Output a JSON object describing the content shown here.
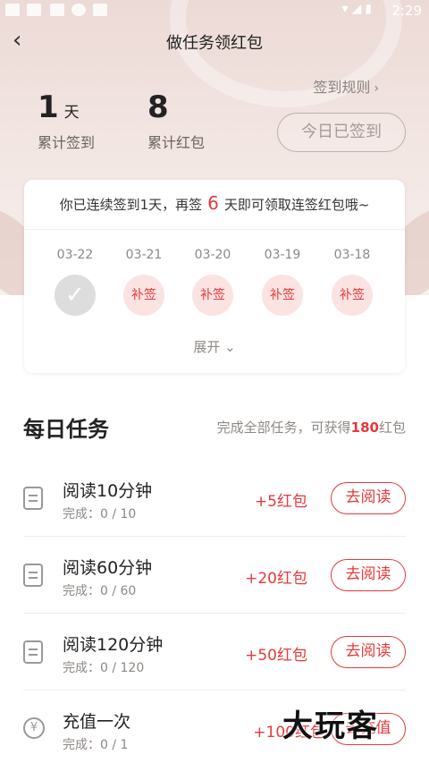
{
  "status_bar": {
    "time": "2:29"
  },
  "header": {
    "title": "做任务领红包",
    "back_icon": "back-chevron-icon"
  },
  "summary": {
    "rules_link": "签到规则",
    "days_value": "1",
    "days_unit": "天",
    "days_caption": "累计签到",
    "packets_value": "8",
    "packets_caption": "累计红包",
    "checkin_button": "今日已签到"
  },
  "checkin_card": {
    "msg_prefix": "你已连续签到1天，再签",
    "msg_days": "6",
    "msg_suffix": "天即可领取连签红包哦~",
    "days": [
      {
        "date": "03-22",
        "status": "done",
        "label": ""
      },
      {
        "date": "03-21",
        "status": "makeup",
        "label": "补签"
      },
      {
        "date": "03-20",
        "status": "makeup",
        "label": "补签"
      },
      {
        "date": "03-19",
        "status": "makeup",
        "label": "补签"
      },
      {
        "date": "03-18",
        "status": "makeup",
        "label": "补签"
      }
    ],
    "expand_label": "展开"
  },
  "daily_tasks": {
    "title": "每日任务",
    "subtitle_prefix": "完成全部任务，可获得",
    "subtitle_amount": "180",
    "subtitle_suffix": "红包",
    "items": [
      {
        "name": "阅读10分钟",
        "progress": "完成：0 / 10",
        "reward": "+5红包",
        "button": "去阅读",
        "icon": "book-icon"
      },
      {
        "name": "阅读60分钟",
        "progress": "完成：0 / 60",
        "reward": "+20红包",
        "button": "去阅读",
        "icon": "book-icon"
      },
      {
        "name": "阅读120分钟",
        "progress": "完成：0 / 120",
        "reward": "+50红包",
        "button": "去阅读",
        "icon": "book-icon"
      },
      {
        "name": "充值一次",
        "progress": "完成：0 / 1",
        "reward": "+100红包",
        "button": "去充值",
        "icon": "yuan-coin-icon"
      }
    ]
  },
  "watermark": "大玩客",
  "colors": {
    "accent": "#e5393b",
    "hero_bg": "#ecdad6",
    "muted": "#8e8884"
  }
}
